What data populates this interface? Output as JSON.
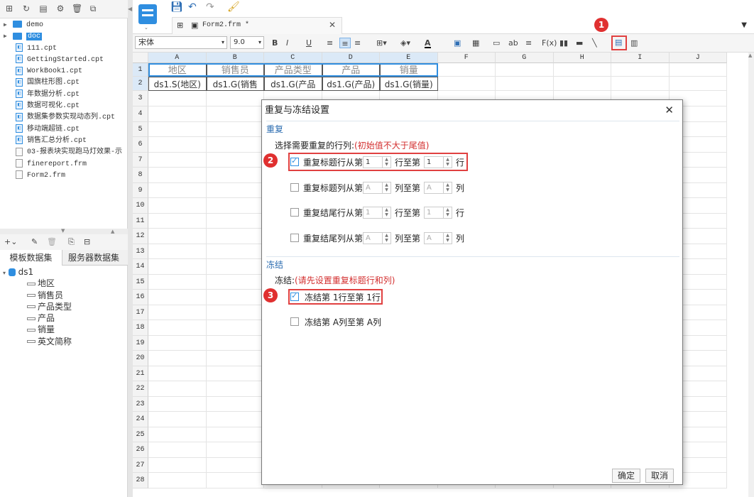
{
  "left_toolbar": [
    "new-icon",
    "refresh-icon",
    "open-icon",
    "settings-icon",
    "delete-icon",
    "copy-icon"
  ],
  "tree": [
    {
      "label": "demo",
      "type": "folder"
    },
    {
      "label": "doc",
      "type": "folder",
      "selected": true
    },
    {
      "label": "111.cpt",
      "type": "cpt"
    },
    {
      "label": "GettingStarted.cpt",
      "type": "cpt"
    },
    {
      "label": "WorkBook1.cpt",
      "type": "cpt"
    },
    {
      "label": "国旗柱形图.cpt",
      "type": "cpt"
    },
    {
      "label": "年数据分析.cpt",
      "type": "cpt"
    },
    {
      "label": "数据可视化.cpt",
      "type": "cpt"
    },
    {
      "label": "数据集参数实现动态列.cpt",
      "type": "cpt"
    },
    {
      "label": "移动端超链.cpt",
      "type": "cpt"
    },
    {
      "label": "销售汇总分析.cpt",
      "type": "cpt"
    },
    {
      "label": "03-报表块实现跑马灯效果-示",
      "type": "frm"
    },
    {
      "label": "finereport.frm",
      "type": "frm"
    },
    {
      "label": "Form2.frm",
      "type": "frm"
    }
  ],
  "dataset_tabs": [
    "模板数据集",
    "服务器数据集"
  ],
  "dataset": {
    "name": "ds1",
    "fields": [
      "地区",
      "销售员",
      "产品类型",
      "产品",
      "销量",
      "英文简称"
    ]
  },
  "doc_tab": "Form2.frm *",
  "font": {
    "name": "宋体",
    "size": "9.0"
  },
  "columns": [
    "A",
    "B",
    "C",
    "D",
    "E",
    "F",
    "G",
    "H",
    "I",
    "J"
  ],
  "rows": [
    "1",
    "2",
    "3",
    "4",
    "5",
    "6",
    "7",
    "8",
    "9",
    "10",
    "11",
    "12",
    "13",
    "14",
    "15",
    "16",
    "17",
    "18",
    "19",
    "20",
    "21",
    "22",
    "23",
    "24",
    "25",
    "26",
    "27",
    "28"
  ],
  "header_cells": [
    "地区",
    "销售员",
    "产品类型",
    "产品",
    "销量"
  ],
  "data_cells": [
    "ds1.S(地区)",
    "ds1.G(销售",
    "ds1.G(产品",
    "ds1.G(产品)",
    "ds1.G(销量)"
  ],
  "dialog": {
    "title": "重复与冻结设置",
    "repeat_section": "重复",
    "repeat_prompt": "选择需要重复的行列:",
    "repeat_hint": "(初始值不大于尾值)",
    "repeat_rows": [
      {
        "label": "重复标题行从第",
        "v1": "1",
        "mid": "行至第",
        "v2": "1",
        "end": "行",
        "checked": true
      },
      {
        "label": "重复标题列从第",
        "v1": "A",
        "mid": "列至第",
        "v2": "A",
        "end": "列",
        "checked": false
      },
      {
        "label": "重复结尾行从第",
        "v1": "1",
        "mid": "行至第",
        "v2": "1",
        "end": "行",
        "checked": false
      },
      {
        "label": "重复结尾列从第",
        "v1": "A",
        "mid": "列至第",
        "v2": "A",
        "end": "列",
        "checked": false
      }
    ],
    "freeze_section": "冻结",
    "freeze_prompt": "冻结:",
    "freeze_hint": "(请先设置重复标题行和列)",
    "freeze_rows": [
      {
        "label": "冻结第 1行至第 1行",
        "checked": true
      },
      {
        "label": "冻结第 A列至第 A列",
        "checked": false
      }
    ],
    "ok": "确定",
    "cancel": "取消",
    "close": "✕"
  },
  "badges": [
    "1",
    "2",
    "3"
  ],
  "colors": {
    "accent": "#2f8ee0",
    "red": "#e03030",
    "hint": "#d32f2f"
  }
}
